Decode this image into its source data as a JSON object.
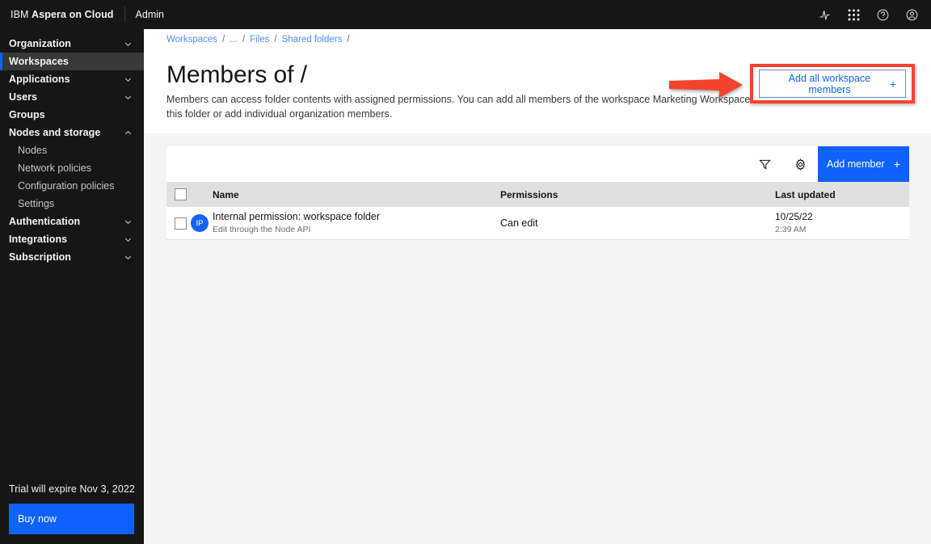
{
  "header": {
    "brand_light": "IBM",
    "brand_bold": "Aspera on Cloud",
    "admin_label": "Admin",
    "icons": [
      {
        "name": "activity-icon",
        "label": "Activity"
      },
      {
        "name": "app-switcher-icon",
        "label": "App switcher"
      },
      {
        "name": "help-icon",
        "label": "Help"
      },
      {
        "name": "account-icon",
        "label": "Account"
      }
    ]
  },
  "sidebar": {
    "items": [
      {
        "label": "Organization",
        "chevron": "down",
        "selected": false,
        "sub": false
      },
      {
        "label": "Workspaces",
        "chevron": "none",
        "selected": true,
        "sub": false
      },
      {
        "label": "Applications",
        "chevron": "down",
        "selected": false,
        "sub": false
      },
      {
        "label": "Users",
        "chevron": "down",
        "selected": false,
        "sub": false
      },
      {
        "label": "Groups",
        "chevron": "none",
        "selected": false,
        "sub": false
      },
      {
        "label": "Nodes and storage",
        "chevron": "up",
        "selected": false,
        "sub": false
      },
      {
        "label": "Nodes",
        "chevron": "none",
        "selected": false,
        "sub": true
      },
      {
        "label": "Network policies",
        "chevron": "none",
        "selected": false,
        "sub": true
      },
      {
        "label": "Configuration policies",
        "chevron": "none",
        "selected": false,
        "sub": true
      },
      {
        "label": "Settings",
        "chevron": "none",
        "selected": false,
        "sub": true
      },
      {
        "label": "Authentication",
        "chevron": "down",
        "selected": false,
        "sub": false
      },
      {
        "label": "Integrations",
        "chevron": "down",
        "selected": false,
        "sub": false
      },
      {
        "label": "Subscription",
        "chevron": "down",
        "selected": false,
        "sub": false
      }
    ],
    "trial_text": "Trial will expire Nov 3, 2022",
    "buy_label": "Buy now"
  },
  "breadcrumb": {
    "items": [
      "Workspaces",
      "...",
      "Files",
      "Shared folders"
    ],
    "separator": "/",
    "trailing_separator": "/"
  },
  "page": {
    "title": "Members of /",
    "description": "Members can access folder contents with assigned permissions. You can add all members of the workspace Marketing Workspace to this folder or add individual organization members."
  },
  "annotation": {
    "color": "#f4432c",
    "arrow": "right-arrow"
  },
  "add_all": {
    "label": "Add all workspace members",
    "plus": "+"
  },
  "toolbar": {
    "filter_icon": "filter-icon",
    "settings_icon": "gear-icon",
    "add_member_label": "Add member",
    "add_member_plus": "+"
  },
  "table": {
    "columns": [
      "Name",
      "Permissions",
      "Last updated"
    ],
    "rows": [
      {
        "avatar_initials": "IP",
        "name": "Internal permission: workspace folder",
        "name_sub": "Edit through the Node API",
        "permission": "Can edit",
        "updated_date": "10/25/22",
        "updated_time": "2:39 AM"
      }
    ]
  },
  "colors": {
    "accent_blue": "#0f62fe",
    "link_blue": "#4f8ef7",
    "annotation_red": "#f4432c",
    "sidebar_bg": "#161616",
    "page_bg": "#f4f4f4",
    "table_header_bg": "#e0e0e0"
  }
}
